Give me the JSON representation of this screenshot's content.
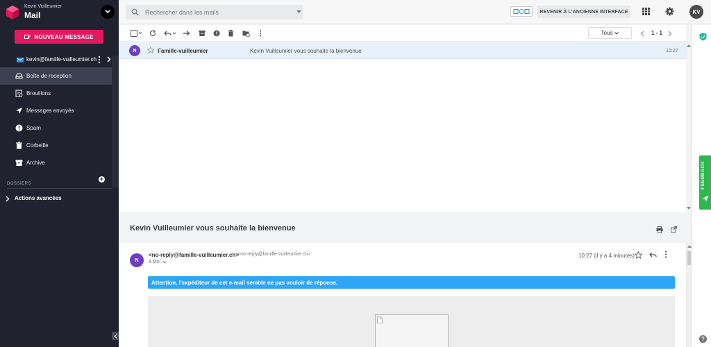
{
  "sidebar": {
    "user_name": "Kevin Vuilleumier",
    "app_name": "Mail",
    "new_message_label": "NOUVEAU MESSAGE",
    "account_email": "kevin@famille-vuilleumier.ch",
    "items": [
      {
        "label": "Boîte de reception",
        "icon": "inbox-icon"
      },
      {
        "label": "Brouillons",
        "icon": "draft-icon"
      },
      {
        "label": "Messages envoyés",
        "icon": "send-icon"
      },
      {
        "label": "Spam",
        "icon": "spam-icon"
      },
      {
        "label": "Corbeille",
        "icon": "trash-icon"
      },
      {
        "label": "Archive",
        "icon": "archive-icon"
      }
    ],
    "folders_label": "DOSSIERS",
    "advanced_label": "Actions avancées"
  },
  "topbar": {
    "search_placeholder": "Rechercher dans les mails",
    "back_to_old_label": "REVENIR À L'ANCIENNE INTERFACE",
    "avatar_initials": "KV"
  },
  "toolbar": {
    "filter_label": "Tous",
    "pager_label": "1 - 1"
  },
  "mail_list": [
    {
      "avatar": "N",
      "sender": "Famille-vuilleumier",
      "subject": "Kevin Vuilleumier vous souhaite la bienvenue",
      "time": "10:27"
    }
  ],
  "reading": {
    "title": "Kevin Vuilleumier vous souhaite la bienvenue",
    "avatar": "N",
    "from_name": "<no-reply@famille-vuilleumier.ch>",
    "from_address": "<no-reply@famille-vuilleumier.ch>",
    "to_label": "à Moi",
    "time": "10:27 (il y a 4 minutes)",
    "warning": "Attention, l'expéditeur de cet e-mail semble ne pas vouloir de réponse."
  },
  "rail": {
    "feedback_label": "FEEDBACK",
    "help_label": "?"
  },
  "colors": {
    "sidebar_bg": "#20232f",
    "accent_pink": "#e4185e",
    "avatar_purple": "#6c3fbf",
    "warning_blue": "#2ea5f5",
    "feedback_green": "#2cb74f",
    "selected_row": "#e7f1fb"
  }
}
